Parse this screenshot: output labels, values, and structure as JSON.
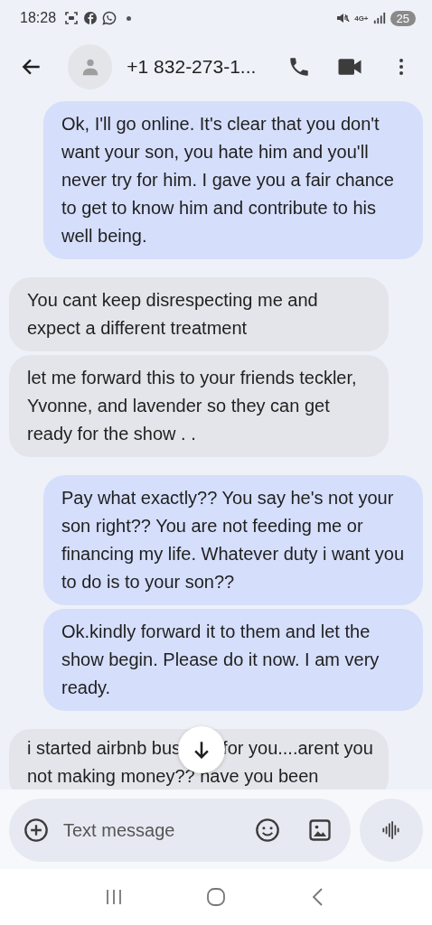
{
  "status_bar": {
    "time": "18:28",
    "network": "4G+",
    "battery": "25"
  },
  "header": {
    "contact": "+1 832-273-1..."
  },
  "messages": [
    {
      "kind": "sent",
      "text": "Ok, I'll go online. It's clear that you don't want your son, you hate him and you'll never try for him. I gave you a fair chance to get to know him and contribute to his well being."
    },
    {
      "kind": "received",
      "text": "You cant keep disrespecting me and expect a different treatment"
    },
    {
      "kind": "received",
      "text": "let me forward this to your friends teckler, Yvonne, and lavender so they can get ready for the show . ."
    },
    {
      "kind": "sent",
      "text": "Pay what exactly?? You say he's not your son right?? You are not feeding me or financing my life. Whatever duty i want you to do is to your son??"
    },
    {
      "kind": "sent",
      "text": "Ok.kindly forward it to them and let the show begin. Please do it now. I am very ready."
    },
    {
      "kind": "covered",
      "text_before": "i started airbnb bus",
      "text_after": "for you....arent you not making money?? have you been"
    }
  ],
  "composer": {
    "placeholder": "Text message"
  }
}
